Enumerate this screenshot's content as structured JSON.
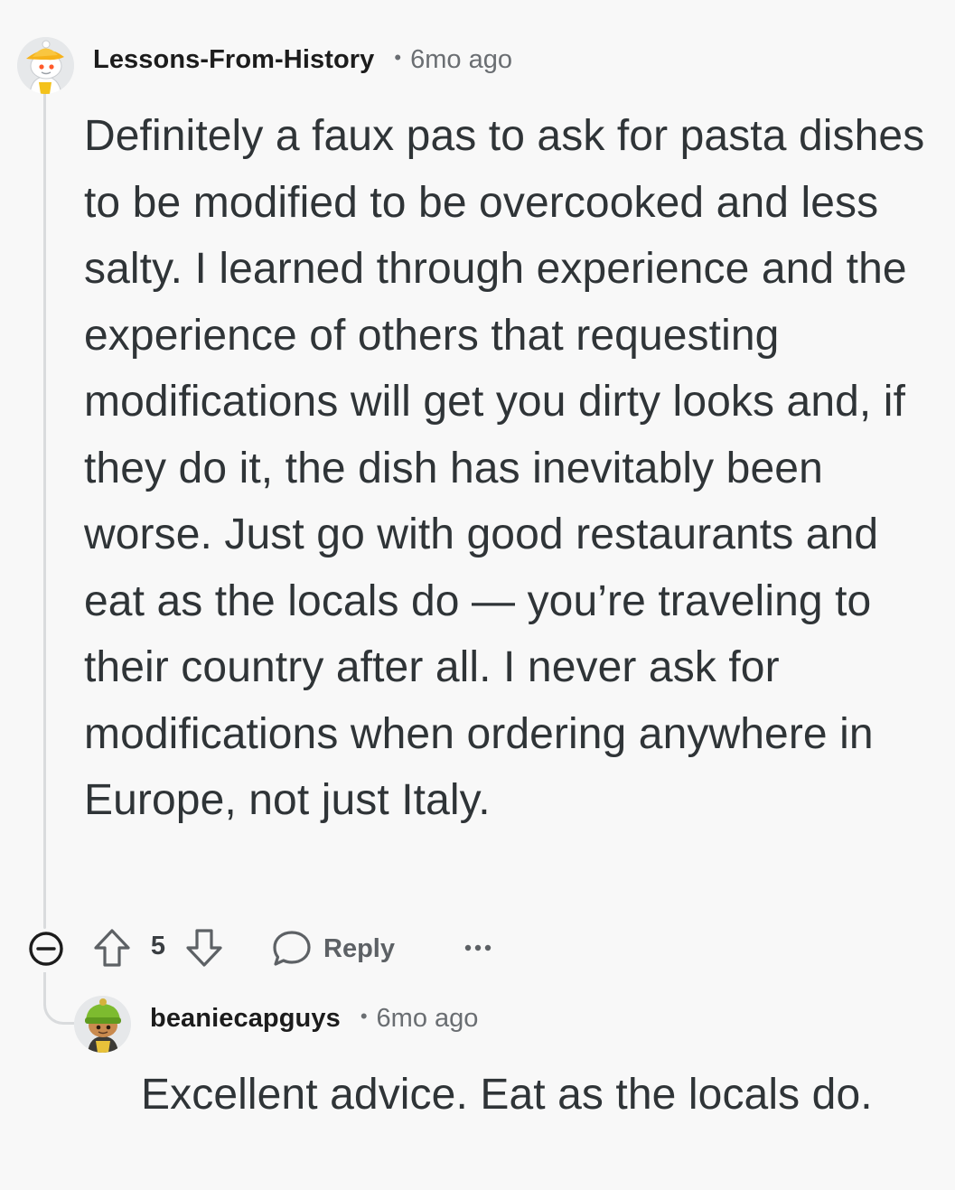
{
  "comments": [
    {
      "username": "Lessons-From-History",
      "separator": "•",
      "time_ago": "6mo ago",
      "avatar_icon": "snoo-avatar-yellow-hat-icon",
      "body": "Definitely a faux pas to ask for pasta dishes to be modified to be overcooked and less salty. I learned through experience and the experience of others that requesting modifications will get you dirty looks and, if they do it, the dish has inevitably been worse. Just go with good restaurants and eat as the locals do — you’re traveling to their country after all. I never ask for modifications when ordering anywhere in Europe, not just Italy.",
      "score": "5",
      "reply_label": "Reply",
      "more_label": "•••"
    },
    {
      "username": "beaniecapguys",
      "separator": "•",
      "time_ago": "6mo ago",
      "avatar_icon": "snoo-avatar-green-beanie-icon",
      "body": "Excellent advice. Eat as the locals do."
    }
  ],
  "icons": {
    "collapse": "collapse-minus-icon",
    "upvote": "upvote-arrow-icon",
    "downvote": "downvote-arrow-icon",
    "reply": "speech-bubble-icon",
    "more": "more-dots-icon"
  },
  "colors": {
    "background": "#f8f8f8",
    "text": "#2f3437",
    "muted": "#6a6e72",
    "rail": "#d9dbdd"
  }
}
